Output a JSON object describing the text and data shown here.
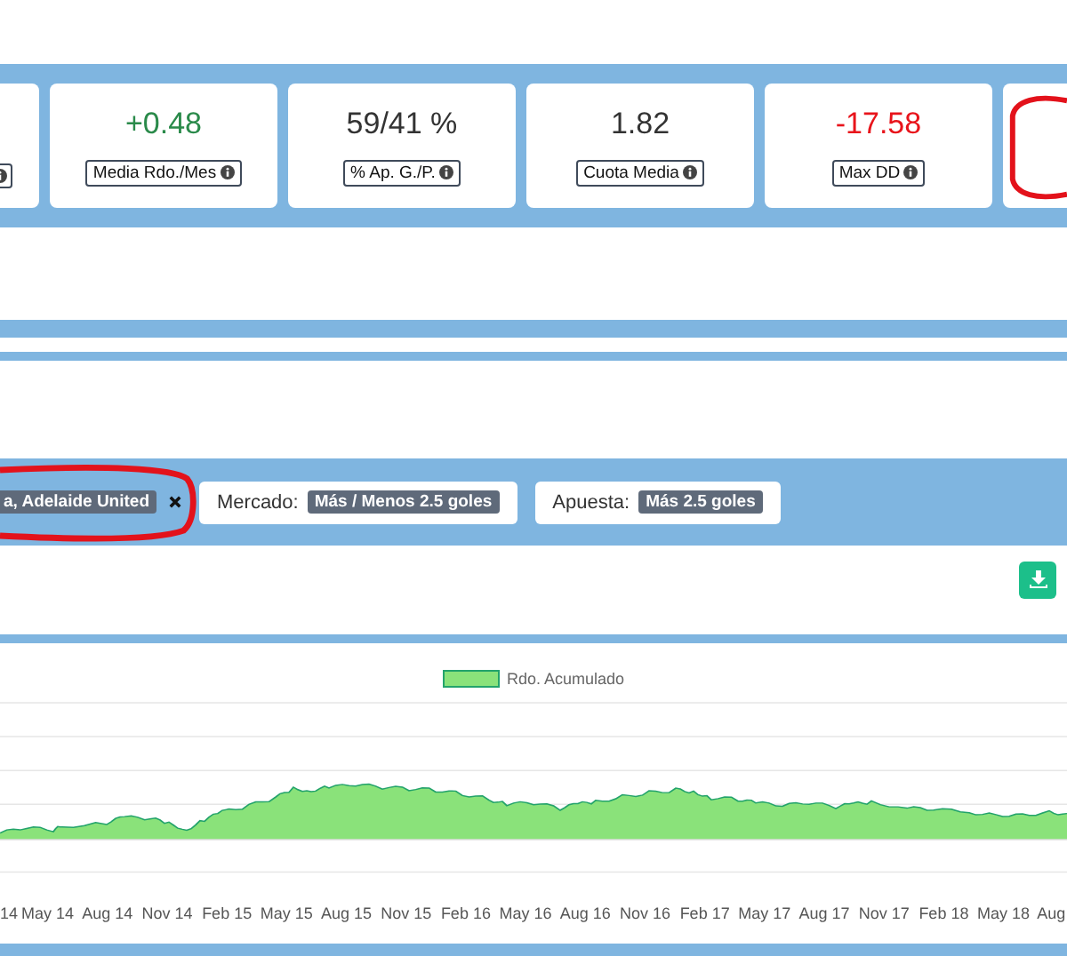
{
  "stats": [
    {
      "kind": "edge"
    },
    {
      "kind": "stat",
      "value": "+0.48",
      "label": "Media Rdo./Mes",
      "color": "#2a8a4a"
    },
    {
      "kind": "stat",
      "value": "59/41 %",
      "label": "% Ap. G./P.",
      "color": "#333333"
    },
    {
      "kind": "stat",
      "value": "1.82",
      "label": "Cuota Media",
      "color": "#333333"
    },
    {
      "kind": "stat",
      "value": "-17.58",
      "label": "Max DD",
      "color": "#e8141b"
    },
    {
      "kind": "edge"
    }
  ],
  "filters": [
    {
      "tag": "a, Adelaide United",
      "removable": true
    },
    {
      "label": "Mercado:",
      "tag": "Más / Menos 2.5 goles",
      "removable": false
    },
    {
      "label": "Apuesta:",
      "tag": "Más 2.5 goles",
      "removable": false
    }
  ],
  "chart": {
    "legend": "Rdo. Acumulado",
    "x_labels": [
      "14",
      "May 14",
      "Aug 14",
      "Nov 14",
      "Feb 15",
      "May 15",
      "Aug 15",
      "Nov 15",
      "Feb 16",
      "May 16",
      "Aug 16",
      "Nov 16",
      "Feb 17",
      "May 17",
      "Aug 17",
      "Nov 17",
      "Feb 18",
      "May 18",
      "Aug"
    ]
  }
}
